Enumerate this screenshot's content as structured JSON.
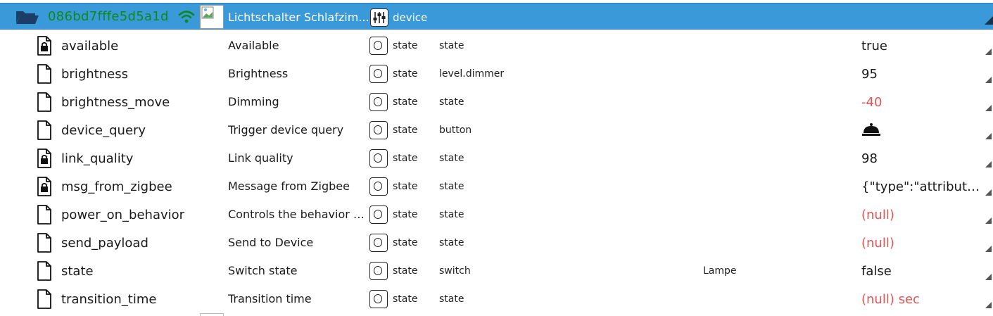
{
  "header": {
    "device_id": "086bd7fffe5d5a1d",
    "name": "Lichtschalter Schlafzim...",
    "role": "device",
    "id_color": "#0b8a1b",
    "background": "#3a9ad9"
  },
  "rows": [
    {
      "icon": "file-lock-icon",
      "id": "available",
      "name": "Available",
      "type": "state",
      "role": "state",
      "room": "",
      "value": "true",
      "value_style": "normal"
    },
    {
      "icon": "file-icon",
      "id": "brightness",
      "name": "Brightness",
      "type": "state",
      "role": "level.dimmer",
      "room": "",
      "value": "95",
      "value_style": "normal"
    },
    {
      "icon": "file-icon",
      "id": "brightness_move",
      "name": "Dimming",
      "type": "state",
      "role": "state",
      "room": "",
      "value": "-40",
      "value_style": "null"
    },
    {
      "icon": "file-icon",
      "id": "device_query",
      "name": "Trigger device query",
      "type": "state",
      "role": "button",
      "room": "",
      "value": "",
      "value_style": "bell"
    },
    {
      "icon": "file-lock-icon",
      "id": "link_quality",
      "name": "Link quality",
      "type": "state",
      "role": "state",
      "room": "",
      "value": "98",
      "value_style": "normal"
    },
    {
      "icon": "file-lock-icon",
      "id": "msg_from_zigbee",
      "name": "Message from Zigbee",
      "type": "state",
      "role": "state",
      "room": "",
      "value": "{\"type\":\"attributeR...",
      "value_style": "normal"
    },
    {
      "icon": "file-icon",
      "id": "power_on_behavior",
      "name": "Controls the behavior w...",
      "type": "state",
      "role": "state",
      "room": "",
      "value": "(null)",
      "value_style": "null"
    },
    {
      "icon": "file-icon",
      "id": "send_payload",
      "name": "Send to Device",
      "type": "state",
      "role": "state",
      "room": "",
      "value": "(null)",
      "value_style": "null"
    },
    {
      "icon": "file-icon",
      "id": "state",
      "name": "Switch state",
      "type": "state",
      "role": "switch",
      "room": "Lampe",
      "value": "false",
      "value_style": "normal"
    },
    {
      "icon": "file-icon",
      "id": "transition_time",
      "name": "Transition time",
      "type": "state",
      "role": "state",
      "room": "",
      "value": "(null) sec",
      "value_style": "null"
    }
  ],
  "colors": {
    "null_value": "#e05555",
    "text": "#1a1a1a"
  }
}
